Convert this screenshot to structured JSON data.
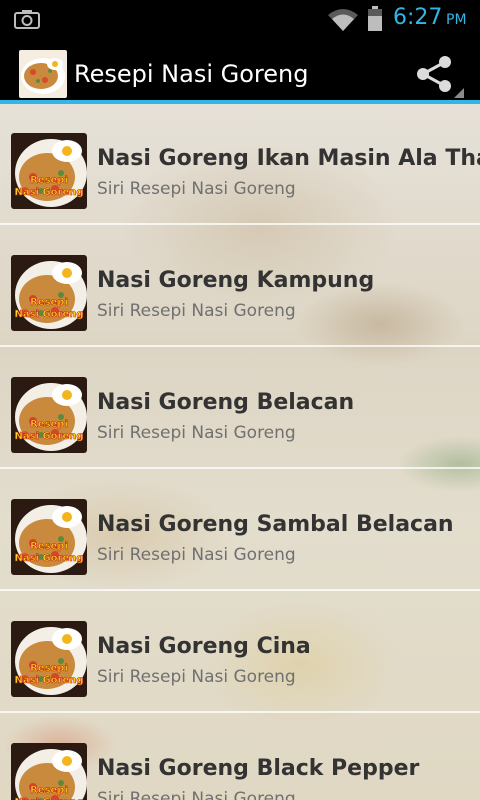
{
  "status_bar": {
    "time": "6:27",
    "ampm": "PM",
    "icons": [
      "camera-icon",
      "wifi-icon",
      "battery-icon"
    ],
    "accent_color": "#33b5e5"
  },
  "action_bar": {
    "title": "Resepi Nasi Goreng",
    "app_icon": "nasi-goreng-app-icon",
    "share_icon": "share-icon"
  },
  "thumbnail": {
    "line1": "Resepi",
    "line2": "Nasi Goreng"
  },
  "items": [
    {
      "title": "Nasi Goreng Ikan Masin Ala Thai",
      "subtitle": "Siri Resepi Nasi Goreng"
    },
    {
      "title": "Nasi Goreng Kampung",
      "subtitle": "Siri Resepi Nasi Goreng"
    },
    {
      "title": "Nasi Goreng Belacan",
      "subtitle": "Siri Resepi Nasi Goreng"
    },
    {
      "title": "Nasi Goreng Sambal Belacan",
      "subtitle": "Siri Resepi Nasi Goreng"
    },
    {
      "title": "Nasi Goreng Cina",
      "subtitle": "Siri Resepi Nasi Goreng"
    },
    {
      "title": "Nasi Goreng Black Pepper",
      "subtitle": "Siri Resepi Nasi Goreng"
    }
  ]
}
